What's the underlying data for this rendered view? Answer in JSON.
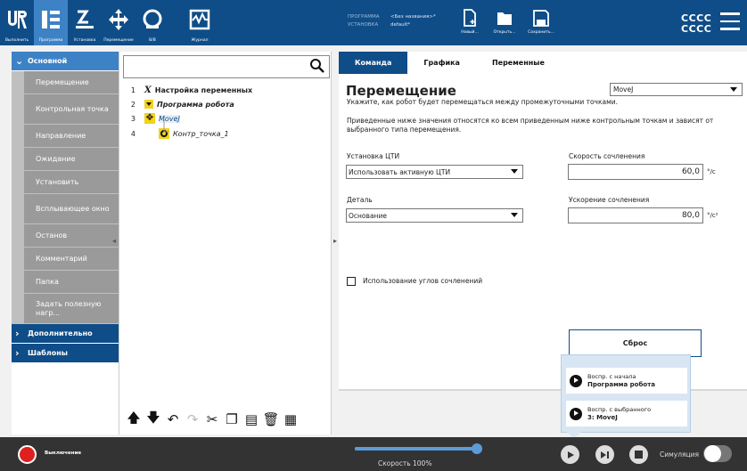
{
  "topbar": {
    "nav": [
      {
        "label": "Выполнить",
        "icon": "ur-logo-icon"
      },
      {
        "label": "Программа",
        "icon": "program-tree-icon"
      },
      {
        "label": "Установка",
        "icon": "installation-robot-icon"
      },
      {
        "label": "Перемещение",
        "icon": "move-arrows-icon"
      },
      {
        "label": "В/В",
        "icon": "io-icon"
      },
      {
        "label": "Журнал",
        "icon": "log-chart-icon"
      }
    ],
    "program_key": "ПРОГРАММА",
    "program_value": "<Без названия>*",
    "installation_key": "УСТАНОВКА",
    "installation_value": "default*",
    "file_buttons": [
      {
        "label": "Новый...",
        "icon": "new-file-icon"
      },
      {
        "label": "Открыть...",
        "icon": "open-folder-icon"
      },
      {
        "label": "Сохранить...",
        "icon": "save-icon"
      }
    ],
    "robot_name_line1": "CCCC",
    "robot_name_line2": "CCCC"
  },
  "sidebar": {
    "basic": "Основной",
    "commands": [
      "Перемещение",
      "Контрольная точка",
      "Направление",
      "Ожидание",
      "Установить",
      "Всплывающее окно",
      "Останов",
      "Комментарий",
      "Папка",
      "Задать полезную нагр..."
    ],
    "advanced": "Дополнительно",
    "templates": "Шаблоны"
  },
  "tree": {
    "rows": [
      {
        "num": "1",
        "text": "Настройка переменных"
      },
      {
        "num": "2",
        "text": "Программа робота"
      },
      {
        "num": "3",
        "text": "MoveJ"
      },
      {
        "num": "4",
        "text": "Контр_точка_1"
      }
    ]
  },
  "tabs": [
    "Команда",
    "Графика",
    "Переменные"
  ],
  "move": {
    "title": "Перемещение",
    "type": "MoveJ",
    "desc1": "Укажите, как робот будет перемещаться между промежуточными точками.",
    "desc2": "Приведенные ниже значения относятся ко всем приведенным ниже контрольным точкам и зависят от выбранного типа перемещения.",
    "tcp_label": "Установка ЦТИ",
    "tcp_value": "Использовать активную ЦТИ",
    "feature_label": "Деталь",
    "feature_value": "Основание",
    "speed_label": "Скорость сочленения",
    "speed_value": "60,0",
    "speed_unit": "°/c",
    "accel_label": "Ускорение сочленения",
    "accel_value": "80,0",
    "accel_unit": "°/c²",
    "blend_label": "Использование углов сочленений",
    "blend_checked": false,
    "reset": "Сброс"
  },
  "play_popup": {
    "from_start_line1": "Воспр. с начала",
    "from_start_line2": "Программа робота",
    "from_selected_line1": "Воспр. с выбранного",
    "from_selected_line2": "3: MoveJ"
  },
  "footer": {
    "power": "Выключение",
    "speed": "Скорость 100%",
    "speed_fraction": 1.0,
    "simulation": "Симуляция",
    "simulation_on": false
  },
  "colors": {
    "topbar": "#0f4d88",
    "active": "#3e82c6",
    "power": "#e02020"
  }
}
